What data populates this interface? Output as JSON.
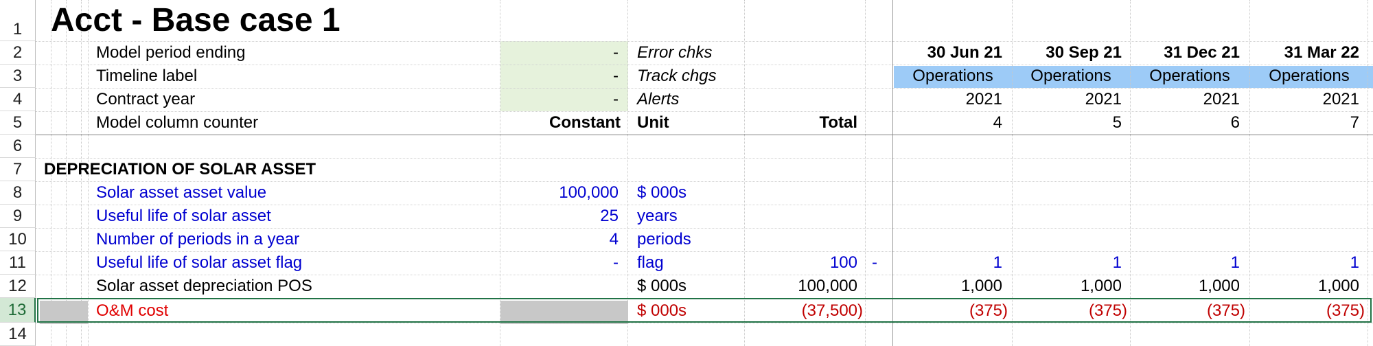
{
  "sheet": {
    "title": "Acct - Base case 1",
    "row_numbers": [
      "1",
      "2",
      "3",
      "4",
      "5",
      "6",
      "7",
      "8",
      "9",
      "10",
      "11",
      "12",
      "13",
      "14"
    ],
    "header_rows": [
      {
        "label": "Model period ending",
        "value": "-",
        "check": "Error chks"
      },
      {
        "label": "Timeline label",
        "value": "-",
        "check": "Track chgs"
      },
      {
        "label": "Contract year",
        "value": "-",
        "check": "Alerts"
      },
      {
        "label": "Model column counter",
        "constant": "Constant",
        "unit": "Unit",
        "total": "Total"
      }
    ],
    "periods": [
      {
        "date": "30 Jun 21",
        "label": "Operations",
        "year": "2021",
        "counter": "4"
      },
      {
        "date": "30 Sep 21",
        "label": "Operations",
        "year": "2021",
        "counter": "5"
      },
      {
        "date": "31 Dec 21",
        "label": "Operations",
        "year": "2021",
        "counter": "6"
      },
      {
        "date": "31 Mar 22",
        "label": "Operations",
        "year": "2021",
        "counter": "7"
      }
    ],
    "section_title": "DEPRECIATION OF SOLAR ASSET",
    "rows": [
      {
        "label": "Solar asset asset value",
        "constant": "100,000",
        "unit": "$ 000s"
      },
      {
        "label": "Useful life of solar asset",
        "constant": "25",
        "unit": "years"
      },
      {
        "label": "Number of periods in a year",
        "constant": "4",
        "unit": "periods"
      },
      {
        "label": "Useful life of solar asset flag",
        "constant": "-",
        "unit": "flag",
        "total": "100",
        "extra": "-",
        "values": [
          "1",
          "1",
          "1",
          "1"
        ]
      },
      {
        "label": "Solar asset depreciation POS",
        "unit": "$ 000s",
        "total": "100,000",
        "values": [
          "1,000",
          "1,000",
          "1,000",
          "1,000"
        ]
      },
      {
        "label": "O&M cost",
        "unit": "$ 000s",
        "total": "(37,500)",
        "values": [
          "(375)",
          "(375)",
          "(375)",
          "(375)"
        ]
      }
    ]
  }
}
